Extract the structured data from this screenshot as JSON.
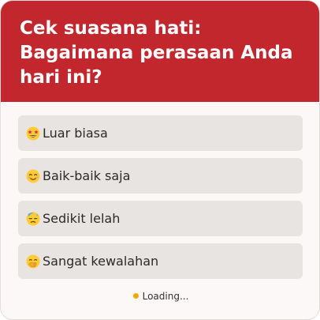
{
  "poll": {
    "title": "Cek suasana hati: Bagaimana perasaan Anda hari ini?",
    "options": [
      {
        "label": "Luar biasa",
        "icon": "star-struck-emoji-icon"
      },
      {
        "label": "Baik-baik saja",
        "icon": "smiling-face-emoji-icon"
      },
      {
        "label": "Sedikit lelah",
        "icon": "downcast-sweat-emoji-icon"
      },
      {
        "label": "Sangat kewalahan",
        "icon": "hand-over-mouth-emoji-icon"
      }
    ],
    "status_text": "Loading..."
  },
  "colors": {
    "header": "#c1272d",
    "option_bg": "#e8e4e2",
    "loading_dot": "#f2a800"
  }
}
